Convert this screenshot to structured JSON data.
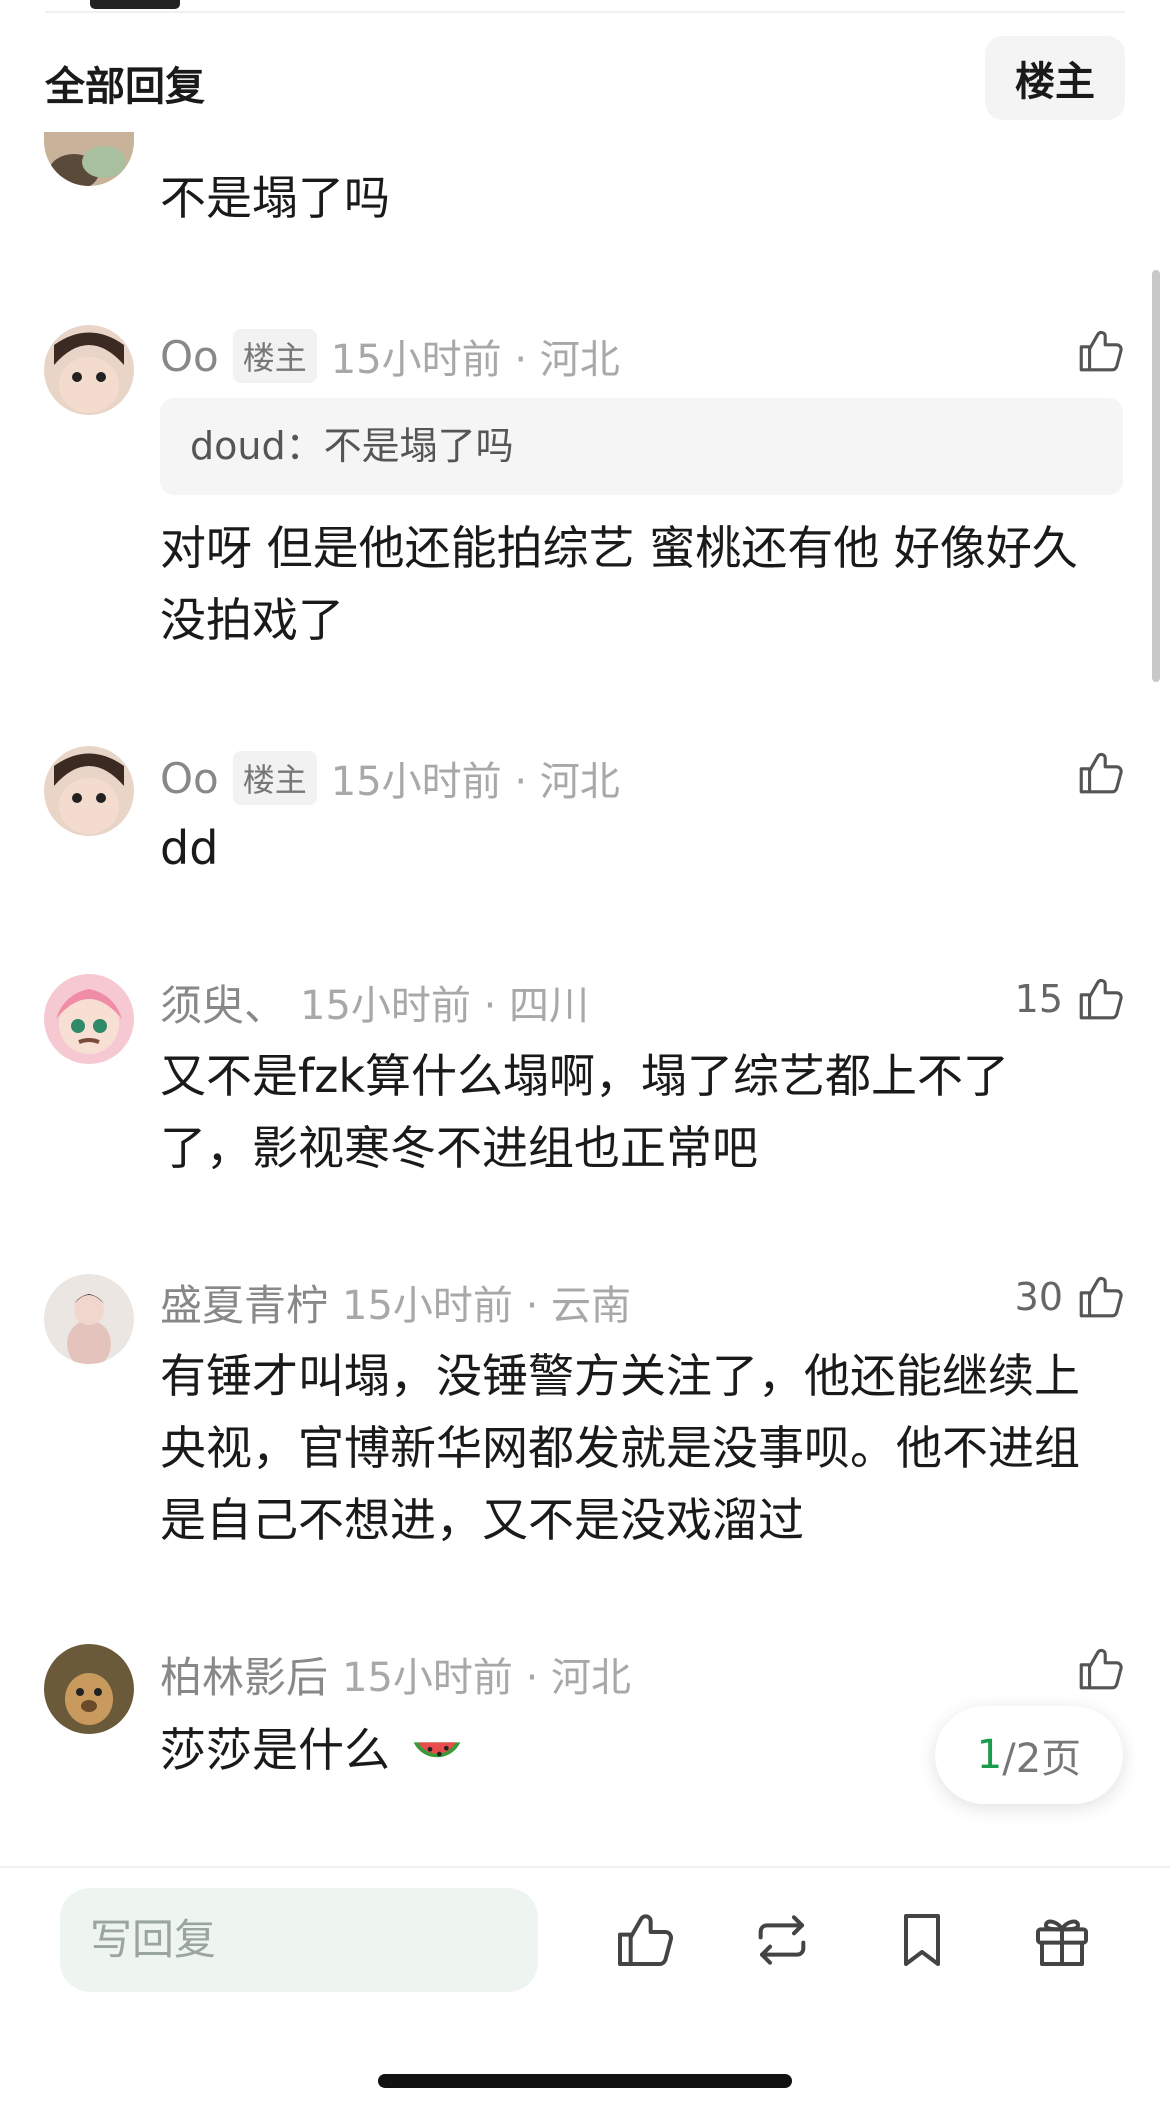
{
  "header": {
    "title": "全部回复",
    "owner_filter": "楼主"
  },
  "comments": [
    {
      "text": "不是塌了吗"
    },
    {
      "name": "Oo",
      "badge": "楼主",
      "time": "15小时前 · 河北",
      "likes": "",
      "quote": "doud：不是塌了吗",
      "text": "对呀 但是他还能拍综艺 蜜桃还有他 好像好久没拍戏了"
    },
    {
      "name": "Oo",
      "badge": "楼主",
      "time": "15小时前 · 河北",
      "likes": "",
      "text": "dd"
    },
    {
      "name": "须臾、",
      "time": "15小时前 · 四川",
      "likes": "15",
      "text": "又不是fzk算什么塌啊，塌了综艺都上不了了，影视寒冬不进组也正常吧"
    },
    {
      "name": "盛夏青柠",
      "time": "15小时前 · 云南",
      "likes": "30",
      "text": "有锤才叫塌，没锤警方关注了，他还能继续上央视，官博新华网都发就是没事呗。他不进组是自己不想进，又不是没戏溜过"
    },
    {
      "name": "柏林影后",
      "time": "15小时前 · 河北",
      "likes": "",
      "text": "莎莎是什么"
    }
  ],
  "pager": {
    "current": "1",
    "total": "/2页"
  },
  "bottom_bar": {
    "reply_placeholder": "写回复"
  },
  "colors": {
    "accent_green": "#1c9b4f",
    "muted_text": "#9a9a9a",
    "input_bg": "#eef5f1"
  },
  "icons": [
    "thumbs-up-icon",
    "repost-icon",
    "bookmark-icon",
    "gift-icon",
    "watermelon-icon"
  ]
}
